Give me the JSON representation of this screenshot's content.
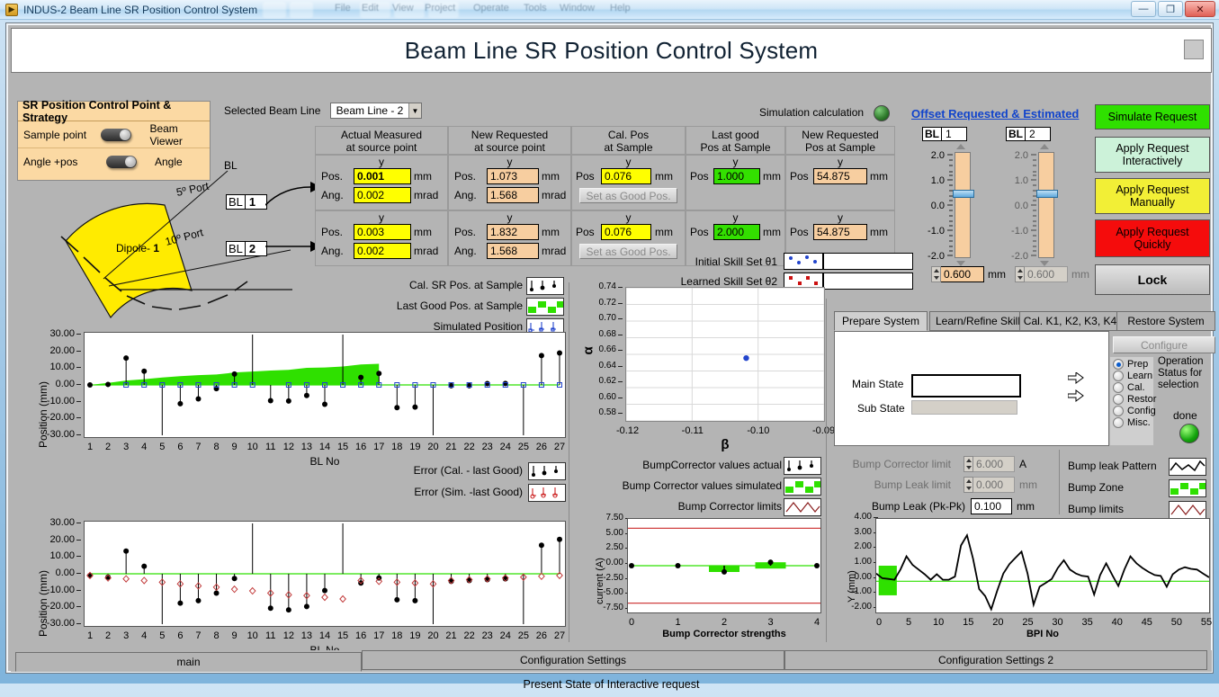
{
  "window": {
    "title": "INDUS-2 Beam Line SR Position Control System",
    "minimize": "—",
    "maximize": "❐",
    "close": "✕",
    "ghost_menus": [
      "File",
      "Edit",
      "View",
      "Project",
      "Operate",
      "Tools",
      "Window",
      "Help"
    ]
  },
  "banner": {
    "title": "Beam Line SR Position Control System"
  },
  "strategy": {
    "header": "SR Position Control Point  & Strategy",
    "rows": [
      {
        "left": "Sample point",
        "right": "Beam Viewer"
      },
      {
        "left": "Angle +pos",
        "right": "Angle"
      }
    ]
  },
  "diagram": {
    "bl_label": "BL",
    "port5": "5º Port",
    "port10": "10º Port",
    "dipole": "Dipole- 1",
    "bl1_prefix": "BL",
    "bl1_value": "1",
    "bl2_prefix": "BL",
    "bl2_value": "2"
  },
  "beamline_select": {
    "label": "Selected Beam Line",
    "value": "Beam Line - 2"
  },
  "simulation": {
    "label": "Simulation calculation"
  },
  "table": {
    "columns": [
      "Actual Measured\nat source point",
      "New Requested\nat source point",
      "Cal. Pos\nat Sample",
      "Last good\nPos at Sample",
      "New Requested\nPos at Sample"
    ],
    "col_headers": [
      {
        "line1": "Actual Measured",
        "line2": "at source point"
      },
      {
        "line1": "New Requested",
        "line2": "at source point"
      },
      {
        "line1": "Cal. Pos",
        "line2": "at Sample"
      },
      {
        "line1": "Last good",
        "line2": "Pos at Sample"
      },
      {
        "line1": "New Requested",
        "line2": "Pos at Sample"
      }
    ],
    "y_label": "y",
    "pos_label": "Pos.",
    "ang_label": "Ang.",
    "pos_short": "Pos",
    "unit_mm": "mm",
    "unit_mrad": "mrad",
    "set_good_button": "Set as Good Pos.",
    "rows": [
      {
        "actual_pos": "0.001",
        "actual_ang": "0.002",
        "requested_pos": "1.073",
        "requested_ang": "1.568",
        "cal_pos": "0.076",
        "last_good": "1.000",
        "new_req_sample": "54.875"
      },
      {
        "actual_pos": "0.003",
        "actual_ang": "0.002",
        "requested_pos": "1.832",
        "requested_ang": "1.568",
        "cal_pos": "0.076",
        "last_good": "2.000",
        "new_req_sample": "54.875"
      }
    ]
  },
  "skill": {
    "initial_label": "Initial Skill Set θ1",
    "learned_label": "Learned Skill Set θ2"
  },
  "offset": {
    "title": "Offset  Requested & Estimated",
    "channels": [
      {
        "bl_prefix": "BL",
        "bl_value": "1",
        "value": "0.600",
        "unit": "mm",
        "ticks": [
          "2.0",
          "1.0",
          "0.0",
          "-1.0",
          "-2.0"
        ],
        "thumb": 0.6,
        "enabled": true
      },
      {
        "bl_prefix": "BL",
        "bl_value": "2",
        "value": "0.600",
        "unit": "mm",
        "ticks": [
          "2.0",
          "1.0",
          "0.0",
          "-1.0",
          "-2.0"
        ],
        "thumb": 0.6,
        "enabled": false
      }
    ]
  },
  "actions": {
    "simulate": "Simulate Request",
    "apply_interactive_l1": "Apply Request",
    "apply_interactive_l2": "Interactively",
    "apply_manual_l1": "Apply Request",
    "apply_manual_l2": "Manually",
    "apply_quick_l1": "Apply Request",
    "apply_quick_l2": "Quickly",
    "lock": "Lock",
    "colors": {
      "simulate": "#2fe000",
      "interactive": "#ccf2d9",
      "manual": "#f2ef36",
      "quick": "#f50c0c",
      "lock": "#cfcfcf"
    }
  },
  "legend_top": [
    {
      "label": "Cal. SR Pos. at Sample",
      "style": "black-stem"
    },
    {
      "label": "Last Good Pos. at Sample",
      "style": "green-square"
    },
    {
      "label": "Simulated Position",
      "style": "blue-stem"
    }
  ],
  "legend_mid": [
    {
      "label": "Error (Cal. - last Good)",
      "style": "black-stem"
    },
    {
      "label": "Error (Sim. -last Good)",
      "style": "red-stem"
    }
  ],
  "legend_bump": [
    {
      "label": "BumpCorrector values actual",
      "style": "black-stem"
    },
    {
      "label": "Bump Corrector values simulated",
      "style": "green-square"
    },
    {
      "label": "Bump Corrector limits",
      "style": "red-zigzag"
    }
  ],
  "legend_leak": [
    {
      "label": "Bump leak Pattern",
      "style": "black-wave"
    },
    {
      "label": "Bump Zone",
      "style": "green-square"
    },
    {
      "label": "Bump limits",
      "style": "red-zigzag"
    }
  ],
  "tabs_right": {
    "items": [
      "Prepare System",
      "Learn/Refine Skill",
      "Cal. K1, K2, K3, K4",
      "Restore System"
    ],
    "active": 0,
    "configure": "Configure",
    "main_state_label": "Main State",
    "sub_state_label": "Sub State",
    "main_state_value": "",
    "sub_state_value": "",
    "radios": [
      "Prep",
      "Learn",
      "Cal.",
      "Restor",
      "Config",
      "Misc."
    ],
    "radio_selected": 0,
    "status_text_l1": "Operation",
    "status_text_l2": "Status for",
    "status_text_l3": "selection",
    "done_label": "done"
  },
  "bump_controls": [
    {
      "label": "Bump Corrector limit",
      "value": "6.000",
      "unit": "A",
      "dim": true,
      "spin": true
    },
    {
      "label": "Bump Leak limit",
      "value": "0.000",
      "unit": "mm",
      "dim": true,
      "spin": true
    },
    {
      "label": "Bump Leak (Pk-Pk)",
      "value": "0.100",
      "unit": "mm",
      "dim": false,
      "spin": false
    }
  ],
  "bottom_tabs": {
    "items": [
      "main",
      "Configuration Settings",
      "Configuration Settings 2"
    ],
    "active": 0
  },
  "status_bar": {
    "text": "Present State of Interactive request"
  },
  "chart_data": [
    {
      "id": "position-top",
      "type": "line",
      "title": "",
      "xlabel": "BL No",
      "ylabel": "Position (mm)",
      "ylim": [
        -30,
        30
      ],
      "yticks": [
        30.0,
        20.0,
        10.0,
        0.0,
        -10.0,
        -20.0,
        -30.0
      ],
      "ytick_labels": [
        "30.00",
        "20.00",
        "10.00",
        "0.00",
        "-10.00",
        "-20.00",
        "-30.00"
      ],
      "x": [
        1,
        2,
        3,
        4,
        5,
        6,
        7,
        8,
        9,
        10,
        11,
        12,
        13,
        14,
        15,
        16,
        17,
        18,
        19,
        20,
        21,
        22,
        23,
        24,
        25,
        26,
        27
      ],
      "xtick_labels": [
        "1",
        "2",
        "3",
        "4",
        "5",
        "6",
        "7",
        "8",
        "9",
        "10",
        "11",
        "12",
        "13",
        "14",
        "15",
        "16",
        "17",
        "18",
        "19",
        "20",
        "21",
        "22",
        "23",
        "24",
        "25",
        "26",
        "27"
      ],
      "grid": false,
      "series": [
        {
          "name": "Cal. SR Pos. at Sample",
          "style": "black-stem",
          "values": [
            0.0,
            0.3,
            16.0,
            8.2,
            -30.0,
            -11.2,
            -8.3,
            -2.2,
            6.5,
            30.0,
            -9.4,
            -9.6,
            -6.3,
            -11.5,
            30.0,
            4.5,
            6.8,
            -13.5,
            -13.2,
            -30.0,
            -0.5,
            -0.5,
            0.8,
            0.9,
            -30.0,
            17.5,
            19.0
          ]
        },
        {
          "name": "Last Good Pos. at Sample",
          "style": "green-area",
          "values": [
            0.0,
            1.2,
            2.6,
            3.4,
            4.4,
            5.2,
            5.8,
            6.2,
            7.4,
            8.0,
            8.6,
            9.0,
            10.2,
            10.4,
            11.0,
            12.2,
            12.6,
            0,
            0,
            0,
            0,
            0,
            0,
            0,
            0,
            0,
            0
          ]
        },
        {
          "name": "Simulated Position",
          "style": "blue-marker",
          "values": [
            0,
            0,
            0,
            0,
            0,
            0,
            0,
            0,
            0,
            0,
            0,
            0,
            0,
            0,
            0,
            0,
            0,
            0,
            0,
            0,
            0,
            0,
            0,
            0,
            0,
            0,
            0
          ]
        }
      ]
    },
    {
      "id": "position-bottom",
      "type": "line",
      "title": "",
      "xlabel": "BL No",
      "ylabel": "Position (mm)",
      "ylim": [
        -30,
        30
      ],
      "yticks": [
        30.0,
        20.0,
        10.0,
        0.0,
        -10.0,
        -20.0,
        -30.0
      ],
      "ytick_labels": [
        "30.00",
        "20.00",
        "10.00",
        "0.00",
        "-10.00",
        "-20.00",
        "-30.00"
      ],
      "x": [
        1,
        2,
        3,
        4,
        5,
        6,
        7,
        8,
        9,
        10,
        11,
        12,
        13,
        14,
        15,
        16,
        17,
        18,
        19,
        20,
        21,
        22,
        23,
        24,
        25,
        26,
        27
      ],
      "xtick_labels": [
        "1",
        "2",
        "3",
        "4",
        "5",
        "6",
        "7",
        "8",
        "9",
        "10",
        "11",
        "12",
        "13",
        "14",
        "15",
        "16",
        "17",
        "18",
        "19",
        "20",
        "21",
        "22",
        "23",
        "24",
        "25",
        "26",
        "27"
      ],
      "grid": false,
      "series": [
        {
          "name": "Error (Cal. - last Good)",
          "style": "black-stem",
          "values": [
            -1.0,
            -2.0,
            13.5,
            4.5,
            -30.0,
            -17.5,
            -16.0,
            -11.5,
            -2.8,
            30.0,
            -20.5,
            -21.5,
            -19.5,
            -10.0,
            30.0,
            -5.5,
            -2.5,
            -15.5,
            -16.0,
            -30.0,
            -4.5,
            -4.0,
            -3.5,
            -3.0,
            -30.0,
            17.0,
            20.5
          ]
        },
        {
          "name": "Error (Sim. -last Good)",
          "style": "red-open",
          "values": [
            -1.0,
            -2.5,
            -3.0,
            -4.0,
            -5.0,
            -6.0,
            -7.2,
            -8.0,
            -9.2,
            -10.2,
            -11.5,
            -12.5,
            -13.0,
            -14.0,
            -15.0,
            -4.0,
            -4.5,
            -5.0,
            -5.5,
            -6.0,
            -4.0,
            -3.5,
            -3.0,
            -2.5,
            -2.0,
            -1.5,
            -1.0
          ]
        }
      ]
    },
    {
      "id": "alpha-beta-scatter",
      "type": "scatter",
      "title": "",
      "xlabel": "β",
      "ylabel": "α",
      "xlim": [
        -0.12,
        -0.09
      ],
      "ylim": [
        0.58,
        0.74
      ],
      "xtick_labels": [
        "-0.12",
        "-0.11",
        "-0.10",
        "-0.09"
      ],
      "ytick_labels": [
        "0.74",
        "0.72",
        "0.70",
        "0.68",
        "0.66",
        "0.64",
        "0.62",
        "0.60",
        "0.58"
      ],
      "grid": true,
      "points": [
        {
          "x": -0.1018,
          "y": 0.6555,
          "color": "#2244cc"
        }
      ]
    },
    {
      "id": "bump-corrector-strengths",
      "type": "bar",
      "title": "",
      "xlabel": "Bump Corrector  strengths",
      "ylabel": "current (A)",
      "xlim": [
        0,
        4
      ],
      "ylim": [
        -7.5,
        7.5
      ],
      "yticks": [
        7.5,
        5.0,
        2.5,
        0.0,
        -2.5,
        -5.0,
        -7.5
      ],
      "ytick_labels": [
        "7.50",
        "5.00",
        "2.50",
        "0.00",
        "-2.50",
        "-5.00",
        "-7.50"
      ],
      "xtick_labels": [
        "0",
        "1",
        "2",
        "3",
        "4"
      ],
      "limit_lines": [
        6.0,
        -6.0
      ],
      "categories": [
        0,
        1,
        2,
        3,
        4
      ],
      "values_simulated": [
        0.0,
        0.0,
        -1.0,
        0.55,
        0.0
      ],
      "values_actual": [
        0.0,
        0.0,
        -1.0,
        0.55,
        0.0
      ],
      "grid": false
    },
    {
      "id": "bump-leak-pattern",
      "type": "line",
      "title": "",
      "xlabel": "BPI No",
      "ylabel": "Y (mm)",
      "xlim": [
        0,
        55
      ],
      "ylim": [
        -2.0,
        4.0
      ],
      "yticks": [
        4.0,
        3.0,
        2.0,
        1.0,
        0.0,
        -1.0,
        -2.0
      ],
      "ytick_labels": [
        "4.00",
        "3.00",
        "2.00",
        "1.00",
        "0.00",
        "-1.00",
        "-2.00"
      ],
      "xtick_labels": [
        "0",
        "5",
        "10",
        "15",
        "20",
        "25",
        "30",
        "35",
        "40",
        "45",
        "50",
        "55"
      ],
      "grid": false,
      "bump_zone": {
        "x0": 0.4,
        "x1": 3.4,
        "y0": -0.9,
        "y1": 1.0
      },
      "x": [
        0,
        1,
        2,
        3,
        4,
        5,
        6,
        7,
        8,
        9,
        10,
        11,
        12,
        13,
        14,
        15,
        16,
        17,
        18,
        19,
        20,
        21,
        22,
        23,
        24,
        25,
        26,
        27,
        28,
        29,
        30,
        31,
        32,
        33,
        34,
        35,
        36,
        37,
        38,
        39,
        40,
        41,
        42,
        43,
        44,
        45,
        46,
        47,
        48,
        49,
        50,
        51,
        52,
        53,
        54,
        55
      ],
      "y": [
        0.5,
        0.2,
        0.15,
        0.1,
        0.75,
        1.6,
        1.05,
        0.75,
        0.45,
        0.1,
        0.45,
        0.1,
        0.1,
        0.3,
        2.3,
        2.95,
        1.45,
        -0.5,
        -0.95,
        -1.8,
        -0.6,
        0.5,
        1.1,
        1.5,
        1.9,
        0.5,
        -1.5,
        -0.35,
        -0.1,
        0.15,
        0.85,
        1.35,
        0.75,
        0.5,
        0.35,
        0.3,
        -0.85,
        0.4,
        1.15,
        0.4,
        -0.3,
        0.75,
        1.6,
        1.15,
        0.85,
        0.6,
        0.4,
        0.35,
        -0.35,
        0.45,
        0.75,
        0.9,
        0.8,
        0.75,
        0.5,
        0.25
      ]
    }
  ]
}
